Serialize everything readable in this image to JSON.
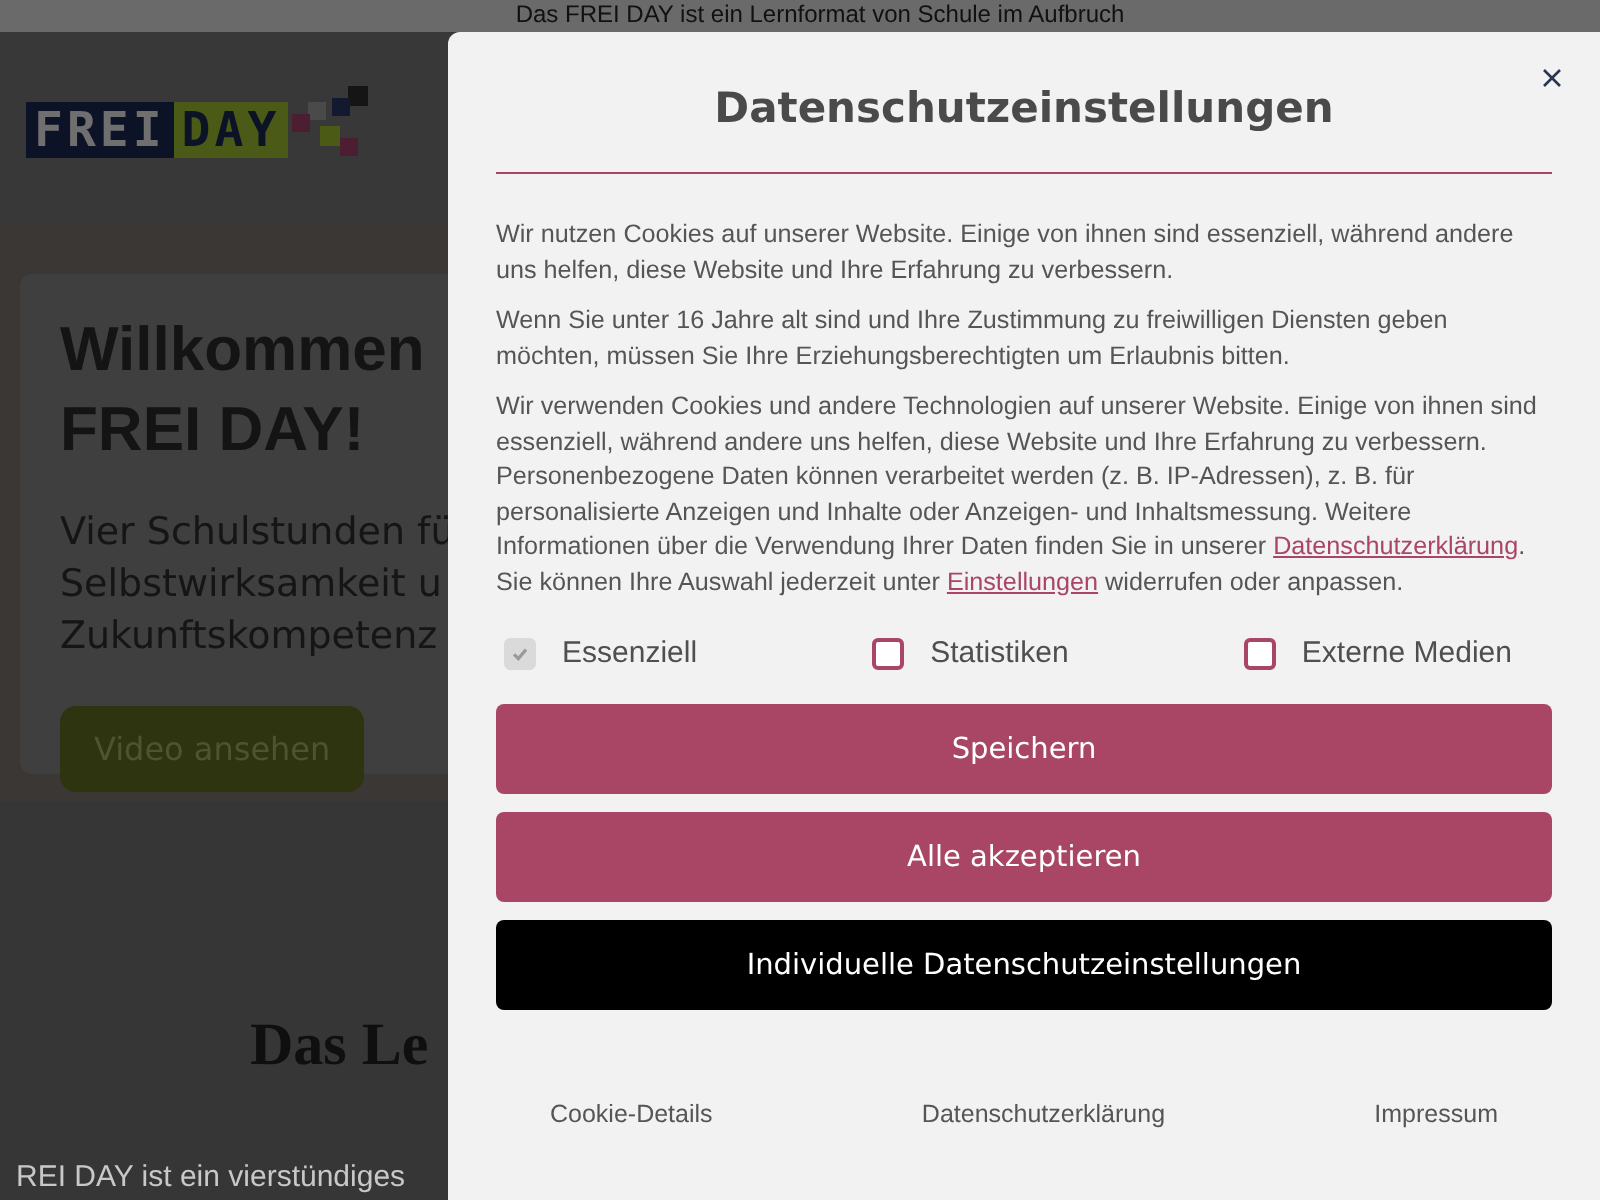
{
  "banner": {
    "text": "Das FREI DAY ist ein Lernformat von Schule im Aufbruch"
  },
  "header": {
    "logo": {
      "word_1": "FREI",
      "word_2": "DAY"
    }
  },
  "hero": {
    "title_lines": [
      "Willkommen",
      "FREI DAY!"
    ],
    "subtitle_lines": [
      "Vier Schulstunden fü",
      "Selbstwirksamkeit u",
      "Zukunftskompetenz"
    ],
    "button": "Video ansehen"
  },
  "section": {
    "heading": "Das Le",
    "text": "REI DAY ist ein vierstündiges"
  },
  "dialog": {
    "title": "Datenschutzeinstellungen",
    "paragraphs": [
      [
        {
          "kind": "text",
          "text": "Wir nutzen Cookies auf unserer Website. Einige von ihnen sind essenziell, während andere uns helfen, diese Website und Ihre Erfahrung zu verbessern."
        }
      ],
      [
        {
          "kind": "text",
          "text": "Wenn Sie unter 16 Jahre alt sind und Ihre Zustimmung zu freiwilligen Diensten geben möchten, müssen Sie Ihre Erziehungsberechtigten um Erlaubnis bitten."
        }
      ],
      [
        {
          "kind": "text",
          "text": "Wir verwenden Cookies und andere Technologien auf unserer Website. Einige von ihnen sind essenziell, während andere uns helfen, diese Website und Ihre Erfahrung zu verbessern. Personenbezogene Daten können verarbeitet werden (z. B. IP-Adressen), z. B. für personalisierte Anzeigen und Inhalte oder Anzeigen- und Inhaltsmessung. Weitere Informationen über die Verwendung Ihrer Daten finden Sie in unserer "
        },
        {
          "kind": "link",
          "text": "Datenschutzerklärung"
        },
        {
          "kind": "text",
          "text": ". Sie können Ihre Auswahl jederzeit unter "
        },
        {
          "kind": "link",
          "text": "Einstellungen"
        },
        {
          "kind": "text",
          "text": " widerrufen oder anpassen."
        }
      ]
    ],
    "options": [
      {
        "label": "Essenziell",
        "checked": true,
        "disabled": true
      },
      {
        "label": "Statistiken",
        "checked": false,
        "disabled": false
      },
      {
        "label": "Externe Medien",
        "checked": false,
        "disabled": false
      }
    ],
    "buttons": [
      {
        "label": "Speichern",
        "kind": "primary"
      },
      {
        "label": "Alle akzeptieren",
        "kind": "primary"
      },
      {
        "label": "Individuelle Datenschutzeinstellungen",
        "kind": "dark"
      }
    ],
    "footer_links": [
      "Cookie-Details",
      "Datenschutzerklärung",
      "Impressum"
    ]
  }
}
